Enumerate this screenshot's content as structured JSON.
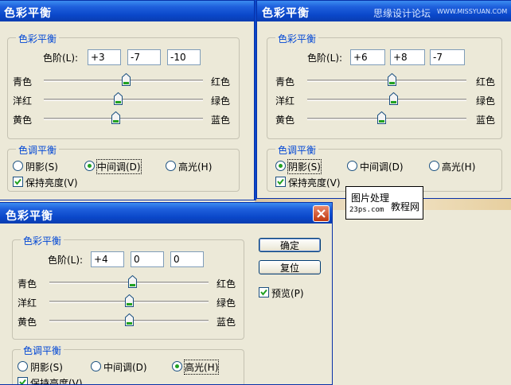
{
  "windows": [
    {
      "title": "色彩平衡",
      "group_color": "色彩平衡",
      "levels_label": "色阶(L):",
      "levels": [
        "+3",
        "-7",
        "-10"
      ],
      "sliders": [
        {
          "left": "青色",
          "right": "红色",
          "value": 3
        },
        {
          "left": "洋红",
          "right": "绿色",
          "value": -7
        },
        {
          "left": "黄色",
          "right": "蓝色",
          "value": -10
        }
      ],
      "group_tone": "色调平衡",
      "tones": [
        "阴影(S)",
        "中间调(D)",
        "高光(H)"
      ],
      "selected_tone": "中间调(D)",
      "preserve_luminosity": "保持亮度(V)",
      "preserve_checked": true
    },
    {
      "title": "色彩平衡",
      "group_color": "色彩平衡",
      "levels_label": "色阶(L):",
      "levels": [
        "+6",
        "+8",
        "-7"
      ],
      "sliders": [
        {
          "left": "青色",
          "right": "红色",
          "value": 6
        },
        {
          "left": "洋红",
          "right": "绿色",
          "value": 8
        },
        {
          "left": "黄色",
          "right": "蓝色",
          "value": -7
        }
      ],
      "group_tone": "色调平衡",
      "tones": [
        "阴影(S)",
        "中间调(D)",
        "高光(H)"
      ],
      "selected_tone": "阴影(S)",
      "preserve_luminosity": "保持亮度(V)",
      "preserve_checked": true
    },
    {
      "title": "色彩平衡",
      "group_color": "色彩平衡",
      "levels_label": "色阶(L):",
      "levels": [
        "+4",
        "0",
        "0"
      ],
      "sliders": [
        {
          "left": "青色",
          "right": "红色",
          "value": 4
        },
        {
          "left": "洋红",
          "right": "绿色",
          "value": 0
        },
        {
          "left": "黄色",
          "right": "蓝色",
          "value": 0
        }
      ],
      "group_tone": "色调平衡",
      "tones": [
        "阴影(S)",
        "中间调(D)",
        "高光(H)"
      ],
      "selected_tone": "高光(H)",
      "preserve_luminosity": "保持亮度(V)",
      "preserve_checked": true,
      "buttons": {
        "ok": "确定",
        "reset": "复位"
      },
      "preview_label": "预览(P)",
      "preview_checked": true
    }
  ],
  "watermark": {
    "text": "思缘设计论坛",
    "url": "WWW.MISSYUAN.COM"
  },
  "tooltip": {
    "line1": "图片处理",
    "line2": "23ps.com",
    "line3": "教程网"
  },
  "colors": {
    "title_blue": "#0a47c9",
    "group_title": "#0046d5",
    "dialog_bg": "#ece9d8",
    "radio_dot": "#21a121",
    "close_red": "#c1380f"
  },
  "icons": {
    "slider": "slider-thumb-icon",
    "close": "close-icon",
    "check": "checkmark-icon"
  }
}
